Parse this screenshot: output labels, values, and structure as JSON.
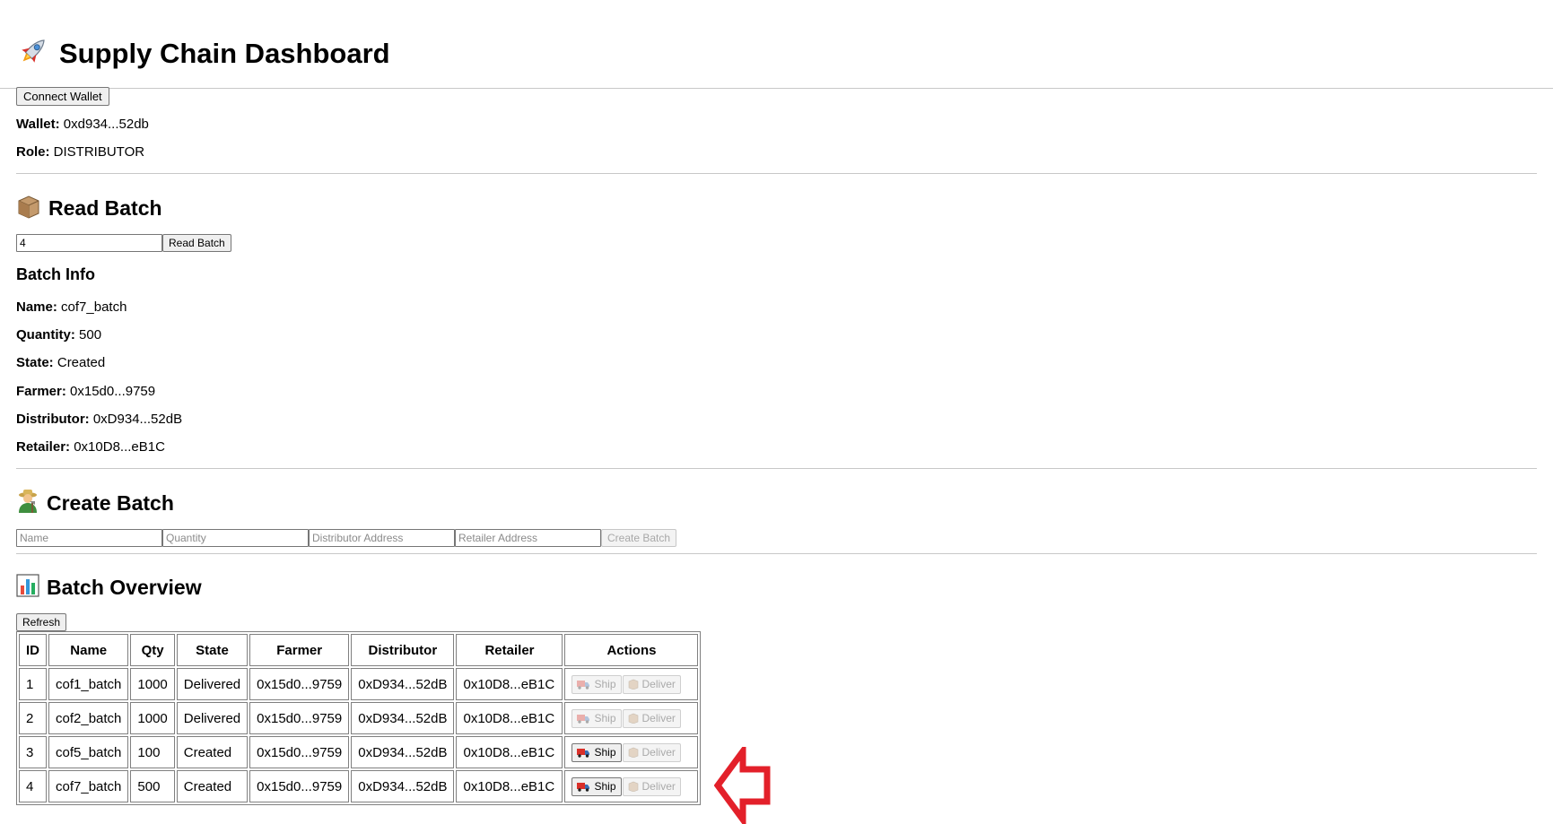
{
  "header": {
    "icon": "rocket-icon",
    "title": "Supply Chain Dashboard"
  },
  "wallet": {
    "connect_label": "Connect Wallet",
    "wallet_label": "Wallet:",
    "wallet_value": "0xd934...52db",
    "role_label": "Role:",
    "role_value": "DISTRIBUTOR"
  },
  "read_batch": {
    "icon": "package-icon",
    "title": "Read Batch",
    "input_value": "4",
    "button_label": "Read Batch",
    "info_title": "Batch Info",
    "fields": [
      {
        "label": "Name:",
        "value": "cof7_batch"
      },
      {
        "label": "Quantity:",
        "value": "500"
      },
      {
        "label": "State:",
        "value": "Created"
      },
      {
        "label": "Farmer:",
        "value": "0x15d0...9759"
      },
      {
        "label": "Distributor:",
        "value": "0xD934...52dB"
      },
      {
        "label": "Retailer:",
        "value": "0x10D8...eB1C"
      }
    ]
  },
  "create_batch": {
    "icon": "farmer-icon",
    "title": "Create Batch",
    "name_placeholder": "Name",
    "quantity_placeholder": "Quantity",
    "distributor_placeholder": "Distributor Address",
    "retailer_placeholder": "Retailer Address",
    "button_label": "Create Batch"
  },
  "overview": {
    "icon": "bar-chart-icon",
    "title": "Batch Overview",
    "refresh_label": "Refresh",
    "columns": [
      "ID",
      "Name",
      "Qty",
      "State",
      "Farmer",
      "Distributor",
      "Retailer",
      "Actions"
    ],
    "ship_label": "Ship",
    "deliver_label": "Deliver",
    "rows": [
      {
        "id": "1",
        "name": "cof1_batch",
        "qty": "1000",
        "state": "Delivered",
        "farmer": "0x15d0...9759",
        "distributor": "0xD934...52dB",
        "retailer": "0x10D8...eB1C",
        "ship_enabled": false,
        "deliver_enabled": false
      },
      {
        "id": "2",
        "name": "cof2_batch",
        "qty": "1000",
        "state": "Delivered",
        "farmer": "0x15d0...9759",
        "distributor": "0xD934...52dB",
        "retailer": "0x10D8...eB1C",
        "ship_enabled": false,
        "deliver_enabled": false
      },
      {
        "id": "3",
        "name": "cof5_batch",
        "qty": "100",
        "state": "Created",
        "farmer": "0x15d0...9759",
        "distributor": "0xD934...52dB",
        "retailer": "0x10D8...eB1C",
        "ship_enabled": true,
        "deliver_enabled": false
      },
      {
        "id": "4",
        "name": "cof7_batch",
        "qty": "500",
        "state": "Created",
        "farmer": "0x15d0...9759",
        "distributor": "0xD934...52dB",
        "retailer": "0x10D8...eB1C",
        "ship_enabled": true,
        "deliver_enabled": false
      }
    ]
  },
  "annotation": {
    "icon": "red-arrow-left-icon",
    "color": "#e3202a"
  }
}
